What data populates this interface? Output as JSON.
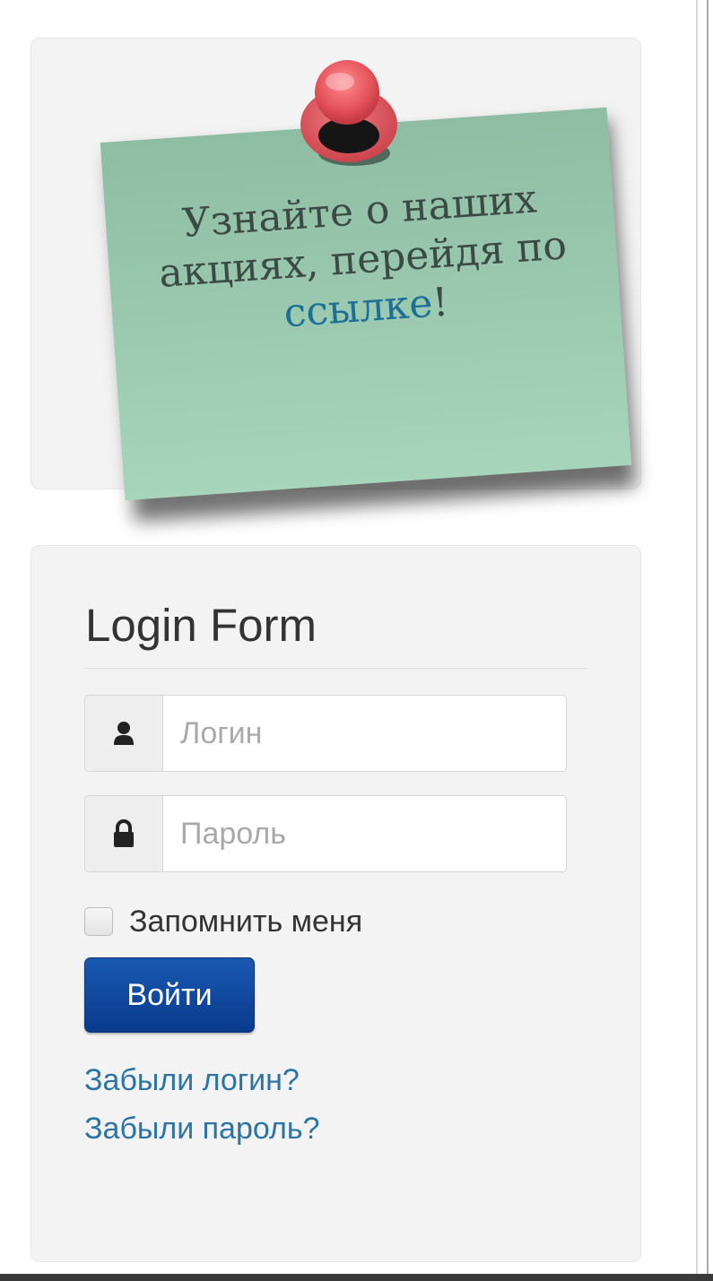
{
  "promo": {
    "text_before": "Узнайте о наших акциях, перейдя по ",
    "link_text": "ссылке",
    "text_after": "!"
  },
  "login": {
    "title": "Login Form",
    "username_placeholder": "Логин",
    "password_placeholder": "Пароль",
    "remember_label": "Запомнить меня",
    "submit_label": "Войти",
    "forgot_login": "Забыли логин?",
    "forgot_password": "Забыли пароль?"
  },
  "icons": {
    "username": "user-icon",
    "password": "lock-icon",
    "pin": "push-pin-icon"
  },
  "colors": {
    "sticky_note": "#9bcab0",
    "pin": "#e4525b",
    "link": "#2d74a6",
    "button": "#083b8c"
  }
}
